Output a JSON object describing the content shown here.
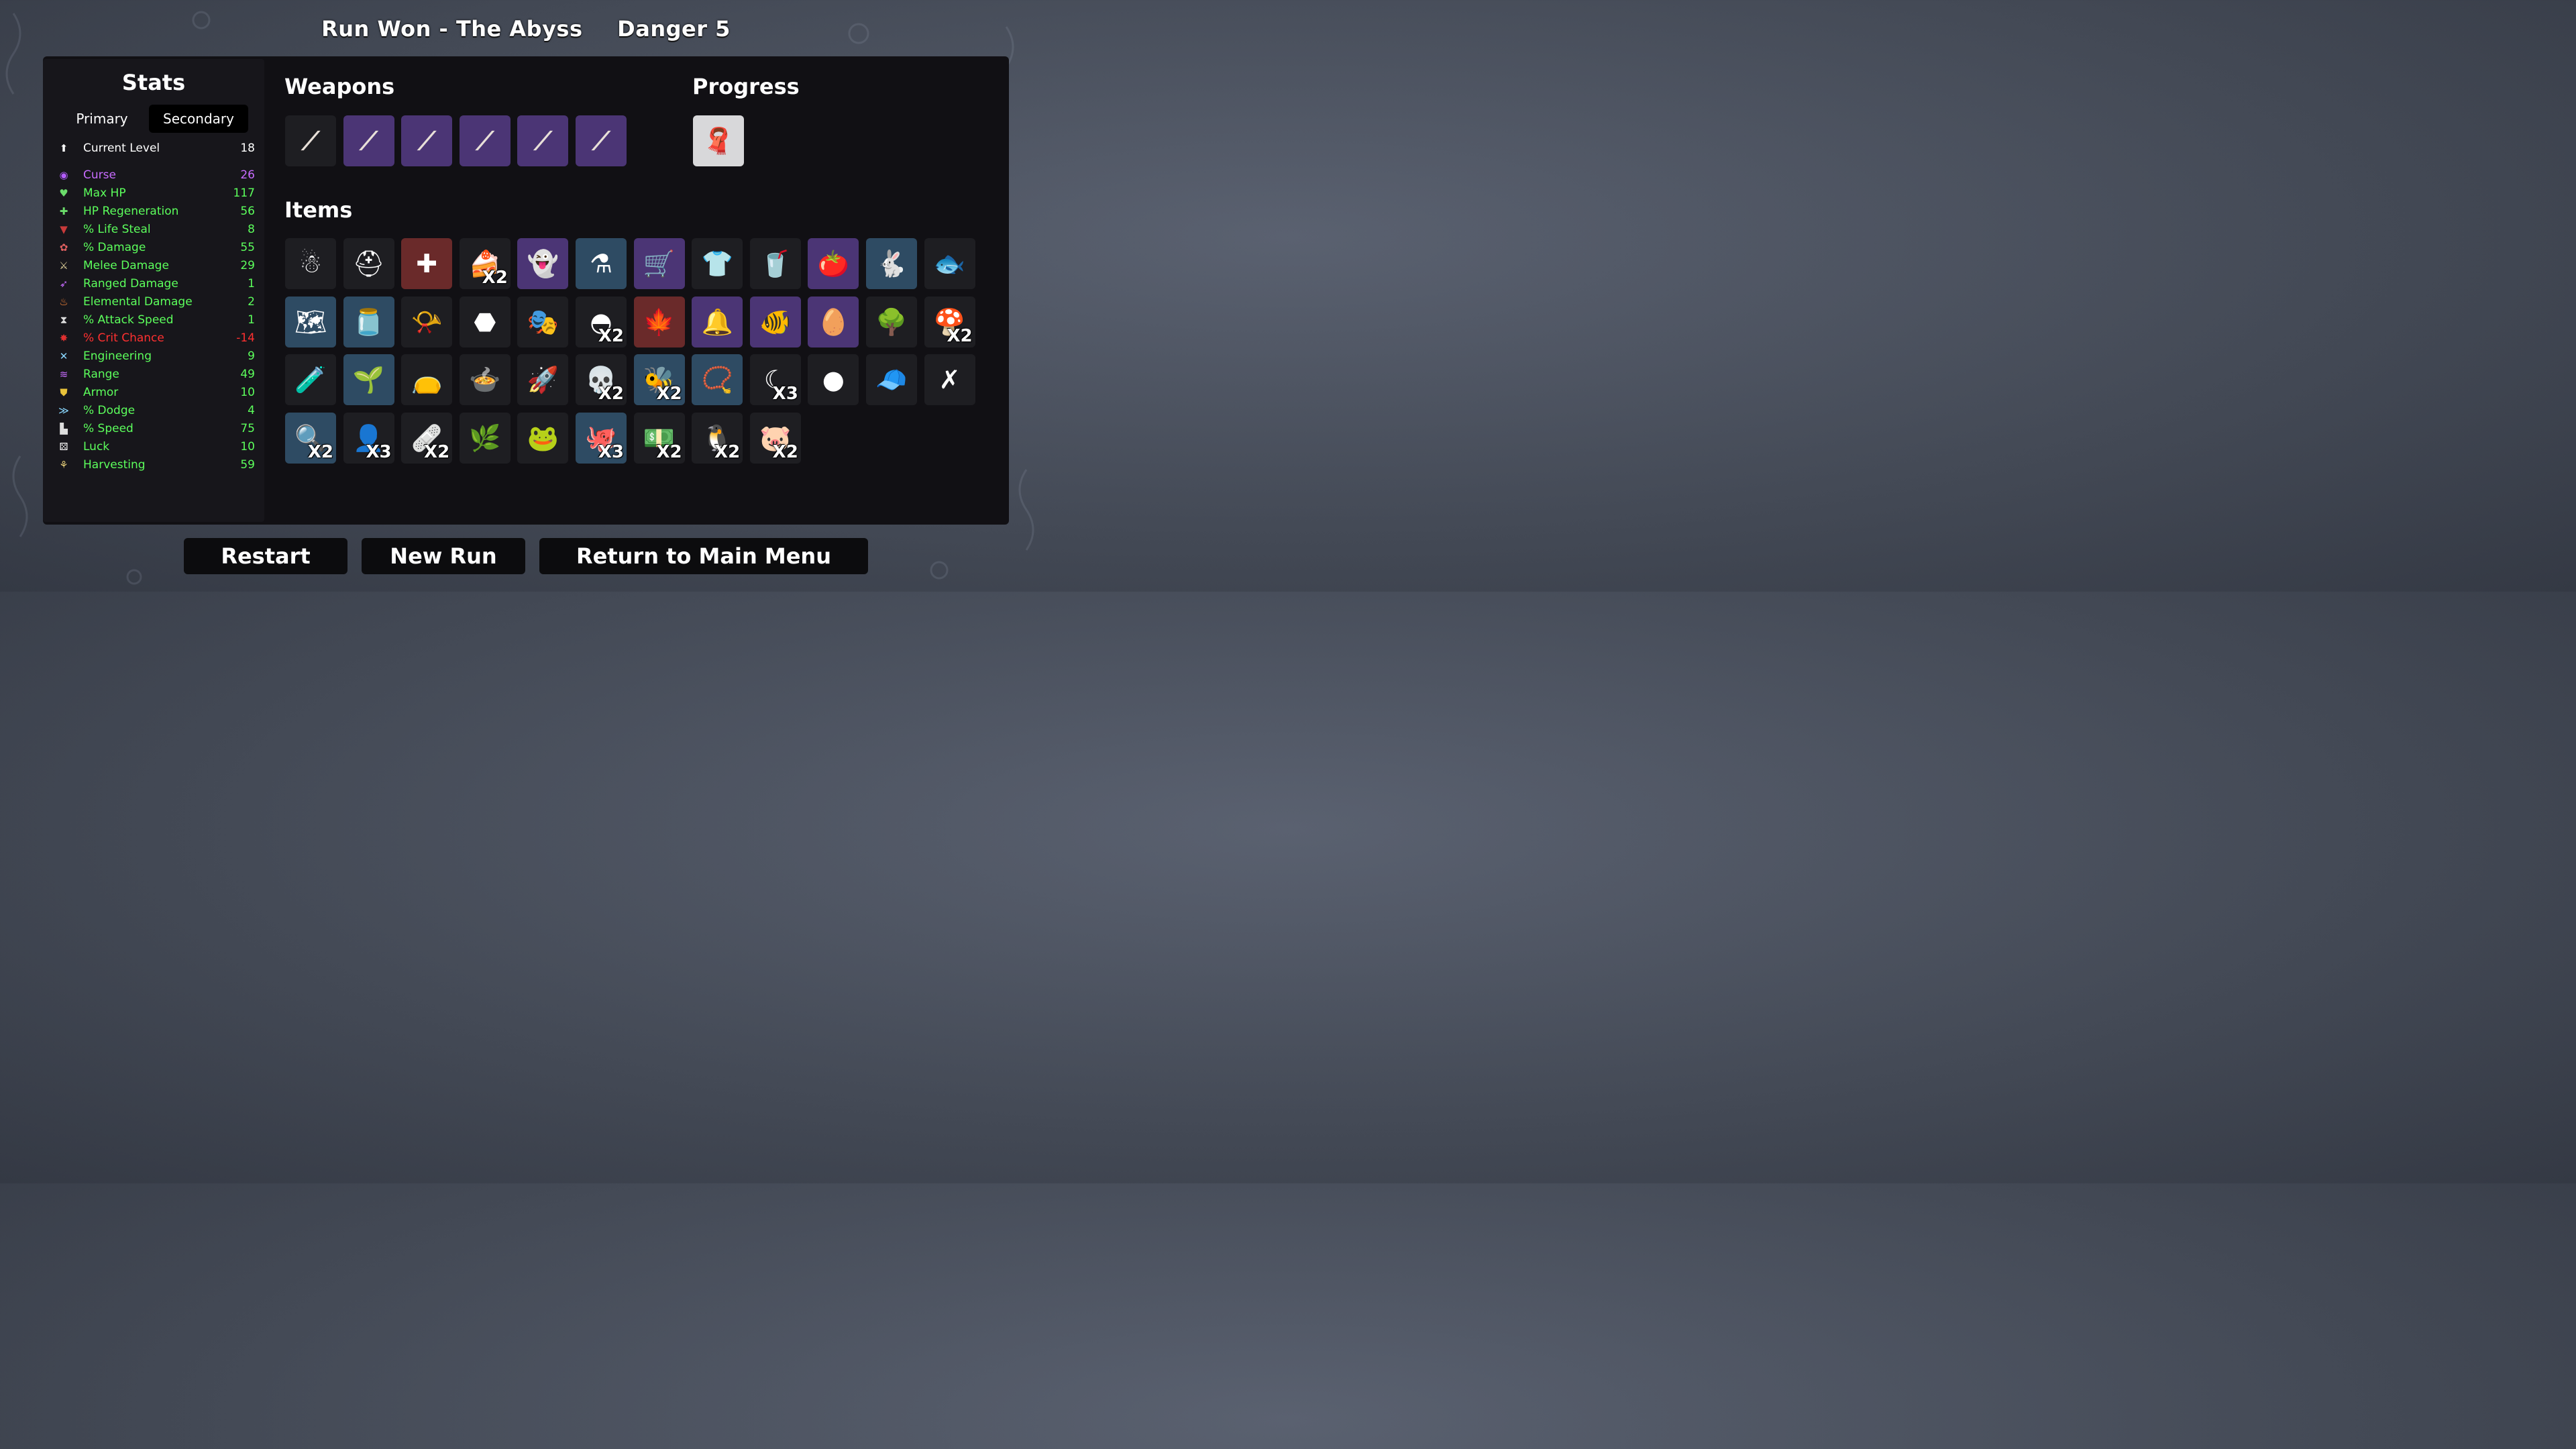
{
  "header": {
    "run_status": "Run Won - The Abyss",
    "danger": "Danger 5"
  },
  "stats": {
    "title": "Stats",
    "tabs": {
      "primary": "Primary",
      "secondary": "Secondary",
      "selected": "Secondary"
    },
    "rows": [
      {
        "label": "Current Level",
        "value": "18",
        "color": "white",
        "icon": "level-up-icon"
      },
      {
        "label": "Curse",
        "value": "26",
        "color": "purple",
        "icon": "curse-eye-icon"
      },
      {
        "label": "Max HP",
        "value": "117",
        "color": "green",
        "icon": "heart-icon"
      },
      {
        "label": "HP Regeneration",
        "value": "56",
        "color": "green",
        "icon": "heart-plus-icon"
      },
      {
        "label": "% Life Steal",
        "value": "8",
        "color": "green",
        "icon": "fangs-icon"
      },
      {
        "label": "% Damage",
        "value": "55",
        "color": "green",
        "icon": "brain-icon"
      },
      {
        "label": "Melee Damage",
        "value": "29",
        "color": "green",
        "icon": "sword-icon"
      },
      {
        "label": "Ranged Damage",
        "value": "1",
        "color": "green",
        "icon": "bow-icon"
      },
      {
        "label": "Elemental Damage",
        "value": "2",
        "color": "green",
        "icon": "flame-icon"
      },
      {
        "label": "% Attack Speed",
        "value": "1",
        "color": "green",
        "icon": "hourglass-icon"
      },
      {
        "label": "% Crit Chance",
        "value": "-14",
        "color": "red",
        "icon": "crit-star-icon"
      },
      {
        "label": "Engineering",
        "value": "9",
        "color": "green",
        "icon": "wrench-icon"
      },
      {
        "label": "Range",
        "value": "49",
        "color": "green",
        "icon": "range-waves-icon"
      },
      {
        "label": "Armor",
        "value": "10",
        "color": "green",
        "icon": "shield-icon"
      },
      {
        "label": "% Dodge",
        "value": "4",
        "color": "green",
        "icon": "dodge-wind-icon"
      },
      {
        "label": "% Speed",
        "value": "75",
        "color": "green",
        "icon": "boot-icon"
      },
      {
        "label": "Luck",
        "value": "10",
        "color": "green",
        "icon": "dice-icon"
      },
      {
        "label": "Harvesting",
        "value": "59",
        "color": "green",
        "icon": "wheat-icon"
      }
    ]
  },
  "weapons": {
    "title": "Weapons",
    "items": [
      {
        "name": "spear-icon",
        "glyph": "⟋",
        "tier": "dark"
      },
      {
        "name": "spear-icon",
        "glyph": "⟋",
        "tier": "purple"
      },
      {
        "name": "spear-icon",
        "glyph": "⟋",
        "tier": "purple"
      },
      {
        "name": "spear-icon",
        "glyph": "⟋",
        "tier": "purple"
      },
      {
        "name": "spear-icon",
        "glyph": "⟋",
        "tier": "purple"
      },
      {
        "name": "spear-icon",
        "glyph": "⟋",
        "tier": "purple"
      }
    ]
  },
  "progress": {
    "title": "Progress",
    "items": [
      {
        "name": "scarf-icon",
        "glyph": "🧣",
        "tier": "light"
      }
    ]
  },
  "items": {
    "title": "Items",
    "rows": [
      [
        {
          "name": "snowman-beanie-icon",
          "glyph": "☃",
          "tier": "dark",
          "qty": ""
        },
        {
          "name": "helmet-icon",
          "glyph": "⛑",
          "tier": "dark",
          "qty": ""
        },
        {
          "name": "medkit-icon",
          "glyph": "✚",
          "tier": "red",
          "qty": ""
        },
        {
          "name": "cake-slice-icon",
          "glyph": "🍰",
          "tier": "dark",
          "qty": "X2"
        },
        {
          "name": "ghost-statue-icon",
          "glyph": "👻",
          "tier": "purple",
          "qty": ""
        },
        {
          "name": "cauldron-icon",
          "glyph": "⚗",
          "tier": "blue",
          "qty": ""
        },
        {
          "name": "wheelbarrow-icon",
          "glyph": "🛒",
          "tier": "purple",
          "qty": ""
        },
        {
          "name": "plaid-shirt-icon",
          "glyph": "👕",
          "tier": "dark",
          "qty": ""
        },
        {
          "name": "lemonade-icon",
          "glyph": "🥤",
          "tier": "dark",
          "qty": ""
        },
        {
          "name": "tomato-icon",
          "glyph": "🍅",
          "tier": "purple",
          "qty": ""
        },
        {
          "name": "rabbit-icon",
          "glyph": "🐇",
          "tier": "blue",
          "qty": ""
        },
        {
          "name": "fish-icon",
          "glyph": "🐟",
          "tier": "dark",
          "qty": ""
        }
      ],
      [
        {
          "name": "treasure-map-icon",
          "glyph": "🗺",
          "tier": "blue",
          "qty": ""
        },
        {
          "name": "jar-icon",
          "glyph": "🫙",
          "tier": "blue",
          "qty": ""
        },
        {
          "name": "whistle-icon",
          "glyph": "📯",
          "tier": "dark",
          "qty": ""
        },
        {
          "name": "coal-icon",
          "glyph": "⬣",
          "tier": "dark",
          "qty": ""
        },
        {
          "name": "tentacle-mask-icon",
          "glyph": "🎭",
          "tier": "dark",
          "qty": ""
        },
        {
          "name": "black-beanie-icon",
          "glyph": "◓",
          "tier": "dark",
          "qty": "X2"
        },
        {
          "name": "rainbow-leaf-icon",
          "glyph": "🍁",
          "tier": "red",
          "qty": ""
        },
        {
          "name": "bell-icon",
          "glyph": "🔔",
          "tier": "purple",
          "qty": ""
        },
        {
          "name": "goldfish-icon",
          "glyph": "🐠",
          "tier": "purple",
          "qty": ""
        },
        {
          "name": "spotted-eggs-icon",
          "glyph": "🥚",
          "tier": "purple",
          "qty": ""
        },
        {
          "name": "tree-icon",
          "glyph": "🌳",
          "tier": "dark",
          "qty": ""
        },
        {
          "name": "mushroom-icon",
          "glyph": "🍄",
          "tier": "dark",
          "qty": "X2"
        }
      ],
      [
        {
          "name": "slime-stack-icon",
          "glyph": "🧪",
          "tier": "dark",
          "qty": ""
        },
        {
          "name": "garden-bed-icon",
          "glyph": "🌱",
          "tier": "blue",
          "qty": ""
        },
        {
          "name": "sack-icon",
          "glyph": "👝",
          "tier": "dark",
          "qty": ""
        },
        {
          "name": "bubbling-pot-icon",
          "glyph": "🍲",
          "tier": "dark",
          "qty": ""
        },
        {
          "name": "spaceship-icon",
          "glyph": "🚀",
          "tier": "dark",
          "qty": ""
        },
        {
          "name": "goat-skull-icon",
          "glyph": "💀",
          "tier": "dark",
          "qty": "X2"
        },
        {
          "name": "wasp-icon",
          "glyph": "🐝",
          "tier": "blue",
          "qty": "X2"
        },
        {
          "name": "pendant-icon",
          "glyph": "📿",
          "tier": "blue",
          "qty": ""
        },
        {
          "name": "crescent-icon",
          "glyph": "☾",
          "tier": "dark",
          "qty": "X3"
        },
        {
          "name": "snowball-icon",
          "glyph": "●",
          "tier": "dark",
          "qty": ""
        },
        {
          "name": "propeller-cap-icon",
          "glyph": "🧢",
          "tier": "dark",
          "qty": ""
        },
        {
          "name": "red-claw-icon",
          "glyph": "✗",
          "tier": "dark",
          "qty": ""
        }
      ],
      [
        {
          "name": "magnifying-glass-icon",
          "glyph": "🔍",
          "tier": "blue",
          "qty": "X2"
        },
        {
          "name": "hooded-figure-icon",
          "glyph": "👤",
          "tier": "dark",
          "qty": "X3"
        },
        {
          "name": "bandage-icon",
          "glyph": "🩹",
          "tier": "dark",
          "qty": "X2"
        },
        {
          "name": "herb-sack-icon",
          "glyph": "🌿",
          "tier": "dark",
          "qty": ""
        },
        {
          "name": "tadpole-icon",
          "glyph": "🐸",
          "tier": "dark",
          "qty": ""
        },
        {
          "name": "octopus-icon",
          "glyph": "🐙",
          "tier": "blue",
          "qty": "X3"
        },
        {
          "name": "cash-icon",
          "glyph": "💵",
          "tier": "dark",
          "qty": "X2"
        },
        {
          "name": "penguin-icon",
          "glyph": "🐧",
          "tier": "dark",
          "qty": "X2"
        },
        {
          "name": "pig-face-icon",
          "glyph": "🐷",
          "tier": "dark",
          "qty": "X2"
        }
      ]
    ]
  },
  "buttons": {
    "restart": "Restart",
    "new_run": "New Run",
    "main_menu": "Return to Main Menu"
  },
  "colors": {
    "green_stat": "#5cff5c",
    "purple_stat": "#c86cff",
    "red_stat": "#ff3030",
    "tier_purple": "#4b3575",
    "tier_blue": "#2e4b63",
    "tier_red": "#6a2a2a"
  }
}
